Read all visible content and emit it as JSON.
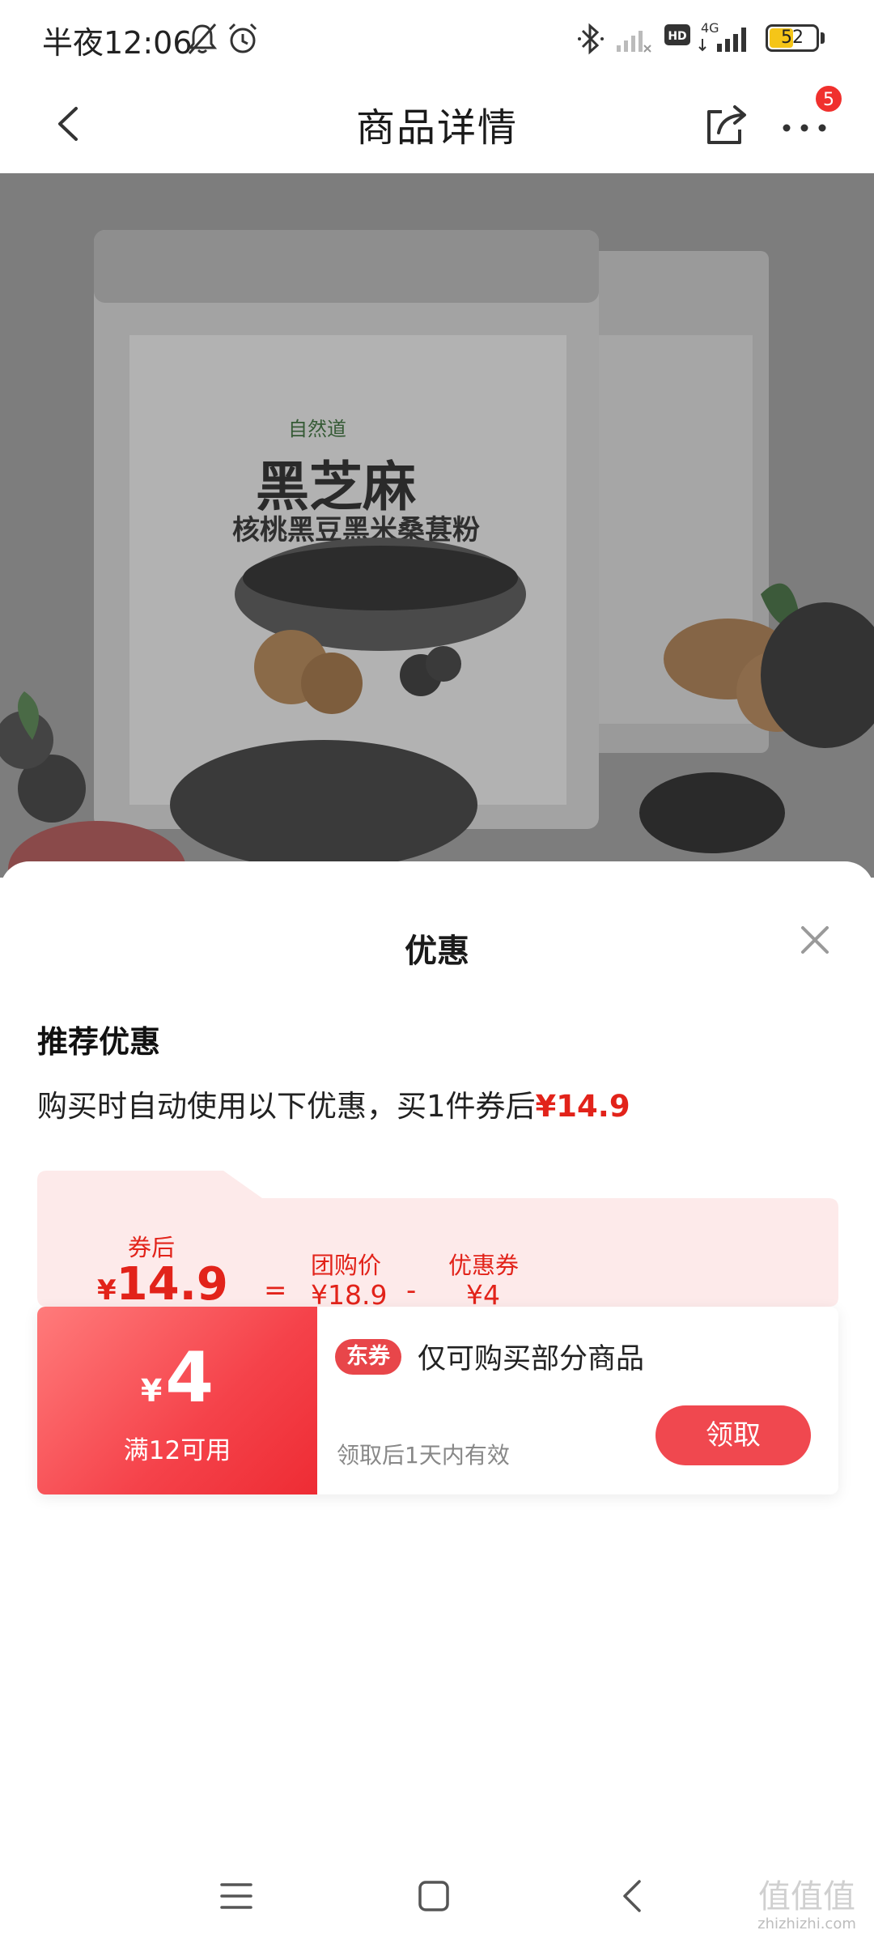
{
  "status_bar": {
    "time": "半夜12:06",
    "network": "4G",
    "hd_label": "HD",
    "battery_percent": "52",
    "battery_level": 0.52
  },
  "header": {
    "title": "商品详情",
    "notification_count": "5",
    "icons": [
      "back-icon",
      "share-icon",
      "more-icon"
    ]
  },
  "product_image": {
    "brand": "自然道",
    "name": "黑芝麻",
    "subtitle": "核桃黑豆黑米桑葚粉"
  },
  "sheet": {
    "title": "优惠",
    "recommend_title": "推荐优惠",
    "recommend_desc_prefix": "购买时自动使用以下优惠，买1件券后",
    "recommend_price": "¥14.9",
    "calc": {
      "after_coupon_label": "券后",
      "after_coupon_yen": "¥",
      "after_coupon_value": "14.9",
      "equals": "=",
      "group_price_label": "团购价",
      "group_price_value": "¥18.9",
      "minus": "-",
      "coupon_label": "优惠券",
      "coupon_value": "¥4"
    },
    "coupon": {
      "yen": "¥",
      "amount": "4",
      "condition": "满12可用",
      "tag": "东券",
      "description": "仅可购买部分商品",
      "validity": "领取后1天内有效",
      "claim_label": "领取"
    }
  },
  "watermark": {
    "glyphs": "值值值",
    "url": "zhizhizhi.com"
  },
  "colors": {
    "accent_red": "#e2231a",
    "coupon_red": "#f0484f",
    "calc_bg": "#fdeaea"
  }
}
